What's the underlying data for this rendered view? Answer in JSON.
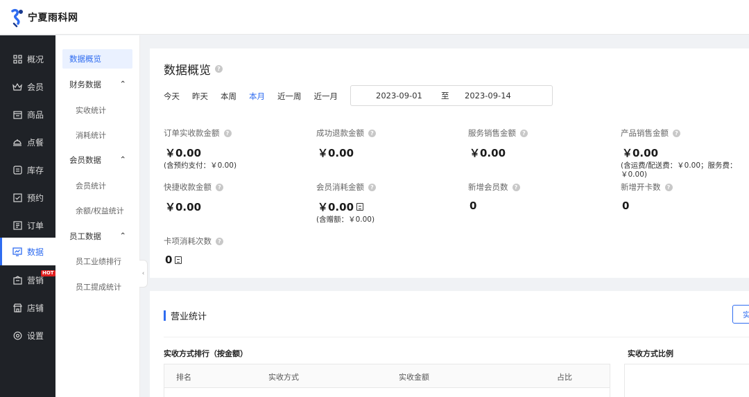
{
  "brand": {
    "name": "宁夏雨科网"
  },
  "nav_primary": [
    {
      "label": "概况",
      "icon": "grid-icon"
    },
    {
      "label": "会员",
      "icon": "crown-icon"
    },
    {
      "label": "商品",
      "icon": "shop-icon"
    },
    {
      "label": "点餐",
      "icon": "dish-icon"
    },
    {
      "label": "库存",
      "icon": "inventory-icon"
    },
    {
      "label": "预约",
      "icon": "calendar-check-icon"
    },
    {
      "label": "订单",
      "icon": "order-icon"
    },
    {
      "label": "数据",
      "icon": "chart-monitor-icon",
      "active": true
    },
    {
      "label": "营销",
      "icon": "marketing-icon",
      "badge": "HOT"
    },
    {
      "label": "店铺",
      "icon": "store-icon"
    },
    {
      "label": "设置",
      "icon": "gear-icon"
    }
  ],
  "nav_secondary": {
    "overview": "数据概览",
    "finance": "财务数据",
    "finance_items": [
      "实收统计",
      "消耗统计"
    ],
    "member": "会员数据",
    "member_items": [
      "会员统计",
      "余额/权益统计"
    ],
    "staff": "员工数据",
    "staff_items": [
      "员工业绩排行",
      "员工提成统计"
    ]
  },
  "overview": {
    "title": "数据概览",
    "tabs": [
      "今天",
      "昨天",
      "本周",
      "本月",
      "近一周",
      "近一月"
    ],
    "active_tab": "本月",
    "date_start": "2023-09-01",
    "date_sep": "至",
    "date_end": "2023-09-14",
    "metrics": [
      {
        "label": "订单实收款金额",
        "value": "￥0.00",
        "note": "(含预约支付：￥0.00)"
      },
      {
        "label": "成功退款金额",
        "value": "￥0.00",
        "note": ""
      },
      {
        "label": "服务销售金额",
        "value": "￥0.00",
        "note": ""
      },
      {
        "label": "产品销售金额",
        "value": "￥0.00",
        "note": "(含运费/配送费：￥0.00；服务费：￥0.00)"
      },
      {
        "label": "快捷收款金额",
        "value": "￥0.00",
        "note": ""
      },
      {
        "label": "会员消耗金额",
        "value": "￥0.00",
        "note": "(含赠额：￥0.00)"
      },
      {
        "label": "新增会员数",
        "value": "0",
        "note": ""
      },
      {
        "label": "新增开卡数",
        "value": "0",
        "note": ""
      },
      {
        "label": "卡项消耗次数",
        "value": "0",
        "note": ""
      }
    ]
  },
  "business": {
    "title": "营业统计",
    "button": "实",
    "ranking_title": "实收方式排行（按金额）",
    "ratio_title": "实收方式比例",
    "columns": [
      "排名",
      "实收方式",
      "实收金额",
      "占比"
    ]
  },
  "colors": {
    "accent": "#2f6cf0",
    "sidebar": "#1f2227",
    "hot": "#e02020"
  }
}
